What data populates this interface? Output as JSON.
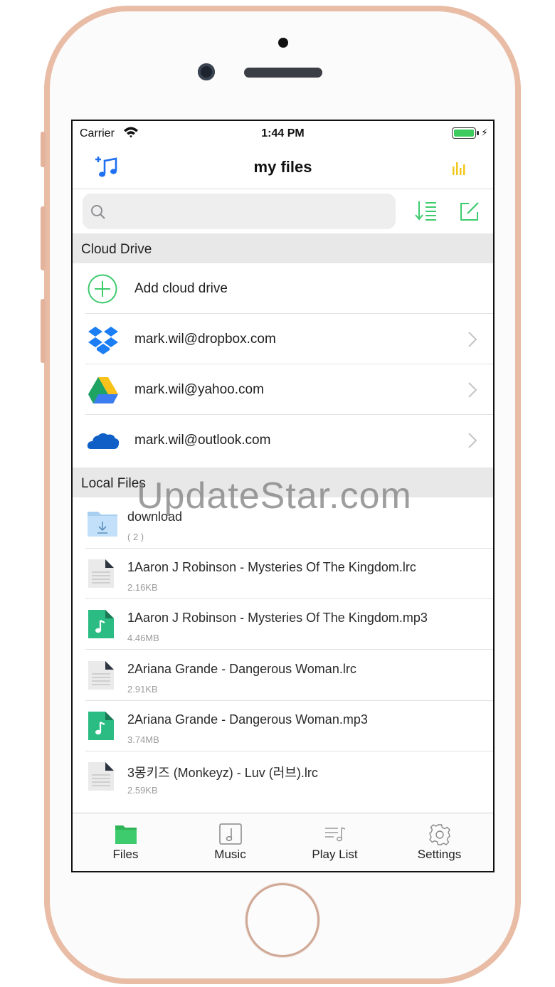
{
  "status_bar": {
    "carrier": "Carrier",
    "time": "1:44 PM"
  },
  "nav": {
    "title": "my files",
    "left_icon": "add-music-icon",
    "right_icon": "equalizer-icon"
  },
  "search": {
    "placeholder": "",
    "value": ""
  },
  "toolbar": {
    "sort_icon": "sort-icon",
    "edit_icon": "edit-icon"
  },
  "cloud_section": {
    "title": "Cloud Drive",
    "add_label": "Add cloud drive",
    "accounts": [
      {
        "label": "mark.wil@dropbox.com",
        "icon": "dropbox-icon"
      },
      {
        "label": "mark.wil@yahoo.com",
        "icon": "google-drive-icon"
      },
      {
        "label": "mark.wil@outlook.com",
        "icon": "onedrive-icon"
      }
    ]
  },
  "local_section": {
    "title": "Local Files",
    "files": [
      {
        "name": "download",
        "meta": "( 2 )",
        "type": "folder"
      },
      {
        "name": "1Aaron J Robinson - Mysteries Of The Kingdom.lrc",
        "meta": "2.16KB",
        "type": "lrc"
      },
      {
        "name": "1Aaron J Robinson - Mysteries Of The Kingdom.mp3",
        "meta": "4.46MB",
        "type": "mp3"
      },
      {
        "name": "2Ariana Grande - Dangerous Woman.lrc",
        "meta": "2.91KB",
        "type": "lrc"
      },
      {
        "name": "2Ariana Grande - Dangerous Woman.mp3",
        "meta": "3.74MB",
        "type": "mp3"
      },
      {
        "name": "3몽키즈 (Monkeyz) - Luv (러브).lrc",
        "meta": "2.59KB",
        "type": "lrc"
      }
    ]
  },
  "tabs": [
    {
      "label": "Files",
      "icon": "folder-icon",
      "active": true
    },
    {
      "label": "Music",
      "icon": "music-note-icon",
      "active": false
    },
    {
      "label": "Play List",
      "icon": "playlist-icon",
      "active": false
    },
    {
      "label": "Settings",
      "icon": "gear-icon",
      "active": false
    }
  ],
  "watermark": "UpdateStar.com",
  "colors": {
    "accent_green": "#3ecb6e",
    "nav_blue": "#1e6ff1",
    "equalizer_yellow": "#f2c81c",
    "phone_rose": "#e9bca6"
  }
}
